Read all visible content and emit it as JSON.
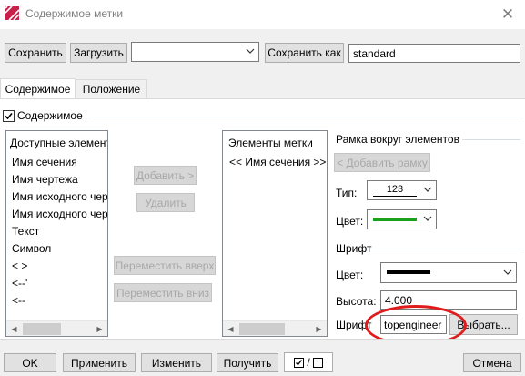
{
  "window": {
    "title": "Содержимое метки"
  },
  "toolbar": {
    "save_label": "Сохранить",
    "load_label": "Загрузить",
    "template_select_value": "",
    "save_as_label": "Сохранить как",
    "save_as_value": "standard"
  },
  "tabs": [
    {
      "label": "Содержимое",
      "active": true
    },
    {
      "label": "Положение",
      "active": false
    }
  ],
  "content_group": {
    "checkbox_label": "Содержимое",
    "checked": true
  },
  "available_list": {
    "header": "Доступные элементы",
    "items": [
      "Имя сечения",
      "Имя чертежа",
      "Имя исходного чертежа",
      "Имя исходного чертежа",
      "Текст",
      "Символ",
      "<  >",
      "<--'",
      "<--"
    ]
  },
  "middle_buttons": {
    "add": "Добавить >",
    "remove": "Удалить",
    "move_up": "Переместить вверх",
    "move_down": "Переместить вниз"
  },
  "label_list": {
    "header": "Элементы метки",
    "items": [
      "<< Имя сечения >>"
    ]
  },
  "frame_group": {
    "title": "Рамка вокруг элементов",
    "add_frame": "< Добавить рамку",
    "type_label": "Тип:",
    "type_value": "123",
    "color_label": "Цвет:",
    "color_value": "#1aa01a"
  },
  "font_group": {
    "title": "Шрифт",
    "color_label": "Цвет:",
    "color_value": "#000000",
    "height_label": "Высота:",
    "height_value": "4.000",
    "font_label": "Шрифт",
    "font_value": "topengineer",
    "choose_button": "Выбрать..."
  },
  "bottom": {
    "ok": "OK",
    "apply": "Применить",
    "modify": "Изменить",
    "get": "Получить",
    "toggle_symbol": "/",
    "cancel": "Отмена"
  },
  "colors": {
    "highlight": "#e01b1b"
  }
}
